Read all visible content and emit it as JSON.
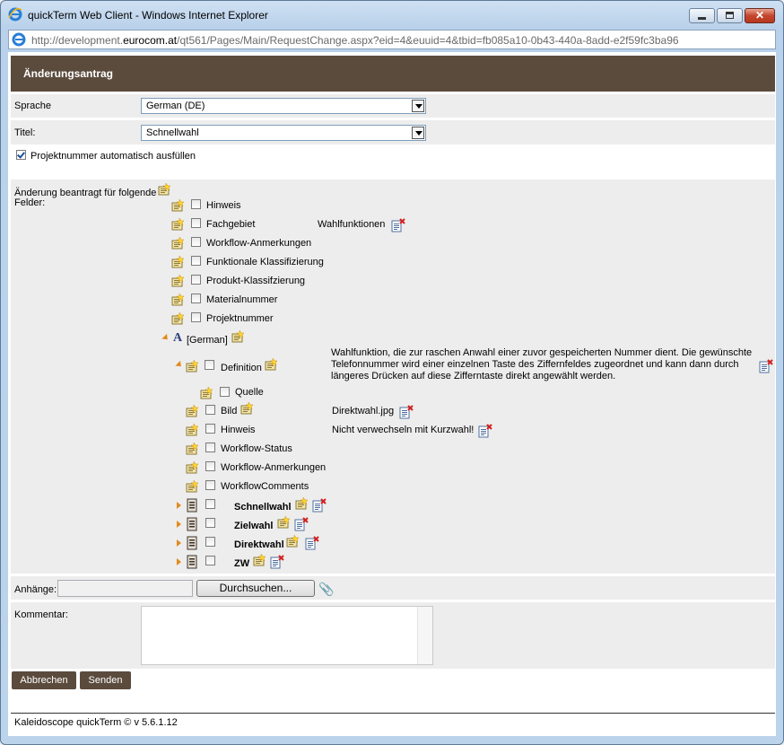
{
  "window": {
    "title": "quickTerm Web Client - Windows Internet Explorer",
    "url_prefix": "http://development.",
    "url_domain": "eurocom.at",
    "url_suffix": "/qt561/Pages/Main/RequestChange.aspx?eid=4&euuid=4&tbid=fb085a10-0b43-440a-8add-e2f59fc3ba96"
  },
  "header": {
    "title": "Änderungsantrag"
  },
  "form": {
    "language_label": "Sprache",
    "language_value": "German (DE)",
    "title_label": "Titel:",
    "title_value": "Schnellwahl",
    "autofill_label": "Projektnummer automatisch ausfüllen",
    "autofill_checked": true,
    "fields_label_1": "Änderung beantragt für folgende",
    "fields_label_2": "Felder:"
  },
  "entry_fields": [
    {
      "label": "Hinweis"
    },
    {
      "label": "Fachgebiet",
      "value": "Wahlfunktionen"
    },
    {
      "label": "Workflow-Anmerkungen"
    },
    {
      "label": "Funktionale Klassifizierung"
    },
    {
      "label": "Produkt-Klassifzierung"
    },
    {
      "label": "Materialnummer"
    },
    {
      "label": "Projektnummer"
    }
  ],
  "language_node": {
    "label": "[German]"
  },
  "definition": {
    "label": "Definition",
    "value": "Wahlfunktion, die zur raschen Anwahl einer zuvor gespeicherten Nummer dient. Die gewünschte Telefonnummer wird einer einzelnen Taste des Ziffernfeldes zugeordnet und kann dann durch längeres Drücken auf diese Zifferntaste direkt angewählt werden.",
    "source_label": "Quelle"
  },
  "language_fields": [
    {
      "label": "Bild",
      "value": "Direktwahl.jpg"
    },
    {
      "label": "Hinweis",
      "value": "Nicht verwechseln mit Kurzwahl!"
    },
    {
      "label": "Workflow-Status"
    },
    {
      "label": "Workflow-Anmerkungen"
    },
    {
      "label": "WorkflowComments"
    }
  ],
  "terms": [
    {
      "label": "Schnellwahl"
    },
    {
      "label": "Zielwahl"
    },
    {
      "label": "Direktwahl"
    },
    {
      "label": "ZW"
    }
  ],
  "attachments": {
    "label": "Anhänge:",
    "browse": "Durchsuchen..."
  },
  "comment": {
    "label": "Kommentar:"
  },
  "buttons": {
    "cancel": "Abbrechen",
    "send": "Senden"
  },
  "footer": {
    "text": "Kaleidoscope quickTerm © v 5.6.1.12"
  },
  "colors": {
    "header_bg": "#5b4b3d",
    "band_bg": "#ededed",
    "expander": "#e28a1e"
  },
  "icons": {
    "edit": "edit-field-icon",
    "delete": "delete-note-icon",
    "term": "term-document-icon",
    "language": "language-a-icon",
    "attach": "paperclip-icon"
  }
}
